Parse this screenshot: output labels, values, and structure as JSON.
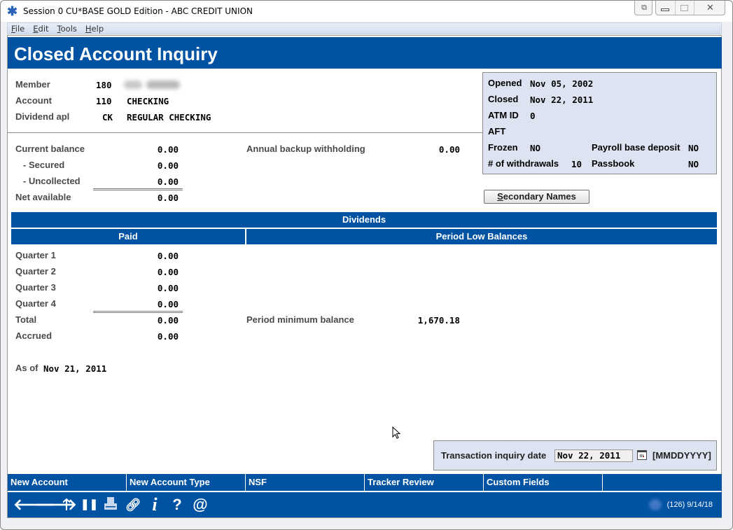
{
  "window": {
    "title": "Session 0 CU*BASE GOLD Edition - ABC CREDIT UNION",
    "controls": [
      "restore-session-icon",
      "minimize-icon",
      "maximize-icon",
      "close-icon"
    ]
  },
  "menu": [
    {
      "label": "File",
      "accel": "F"
    },
    {
      "label": "Edit",
      "accel": "E"
    },
    {
      "label": "Tools",
      "accel": "T"
    },
    {
      "label": "Help",
      "accel": "H"
    }
  ],
  "header": {
    "title": "Closed Account Inquiry"
  },
  "member_info": {
    "member_label": "Member",
    "member_value": "180",
    "account_label": "Account",
    "account_value": "110",
    "account_desc": "CHECKING",
    "dividend_label": "Dividend apl",
    "dividend_value": "CK",
    "dividend_desc": "REGULAR CHECKING"
  },
  "info_box": {
    "opened_label": "Opened",
    "opened_value": "Nov 05, 2002",
    "closed_label": "Closed",
    "closed_value": "Nov 22, 2011",
    "atm_label": "ATM ID",
    "atm_value": "0",
    "aft_label": "AFT",
    "aft_value": "",
    "frozen_label": "Frozen",
    "frozen_value": "NO",
    "payroll_label": "Payroll base deposit",
    "payroll_value": "NO",
    "withdrawals_label": "# of withdrawals",
    "withdrawals_value": "10",
    "passbook_label": "Passbook",
    "passbook_value": "NO"
  },
  "secondary_names_button": {
    "label": "Secondary Names",
    "accel": "S"
  },
  "balances": {
    "current_label": "Current balance",
    "current_value": "0.00",
    "secured_label": "- Secured",
    "secured_value": "0.00",
    "uncollected_label": "- Uncollected",
    "uncollected_value": "0.00",
    "net_label": "Net available",
    "net_value": "0.00",
    "backup_label": "Annual backup withholding",
    "backup_value": "0.00"
  },
  "dividends": {
    "title": "Dividends",
    "paid_header": "Paid",
    "low_header": "Period Low Balances",
    "quarters": [
      {
        "label": "Quarter 1",
        "value": "0.00"
      },
      {
        "label": "Quarter 2",
        "value": "0.00"
      },
      {
        "label": "Quarter 3",
        "value": "0.00"
      },
      {
        "label": "Quarter 4",
        "value": "0.00"
      }
    ],
    "total_label": "Total",
    "total_value": "0.00",
    "accrued_label": "Accrued",
    "accrued_value": "0.00",
    "period_min_label": "Period minimum balance",
    "period_min_value": "1,670.18",
    "as_of_label": "As of",
    "as_of_value": "Nov 21, 2011"
  },
  "inquiry_date": {
    "label": "Transaction inquiry date",
    "value": "Nov 22, 2011",
    "format_hint": "[MMDDYYYY]"
  },
  "function_keys": [
    "New Account",
    "New Account Type",
    "NSF",
    "Tracker Review",
    "Custom Fields",
    ""
  ],
  "toolbar": {
    "icons": [
      "back-arrow-icon",
      "forward-arrow-icon",
      "up-arrow-icon",
      "pause-icon",
      "print-icon",
      "link-icon",
      "info-icon",
      "help-icon",
      "email-icon"
    ],
    "status": "(126) 9/14/18"
  }
}
